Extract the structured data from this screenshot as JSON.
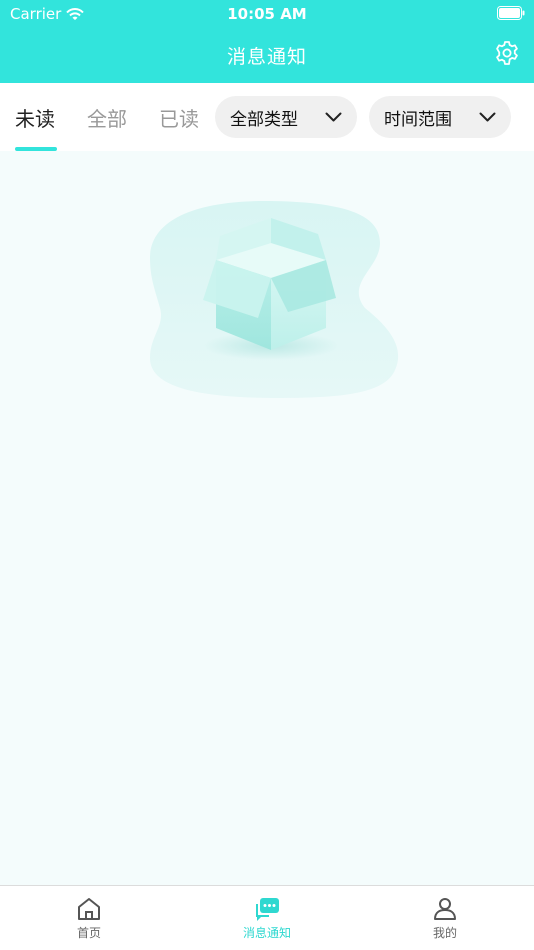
{
  "status_bar": {
    "carrier": "Carrier",
    "time": "10:05 AM"
  },
  "nav": {
    "title": "消息通知",
    "settings_icon": "gear-icon"
  },
  "tabs": [
    {
      "label": "未读",
      "active": true
    },
    {
      "label": "全部",
      "active": false
    },
    {
      "label": "已读",
      "active": false
    }
  ],
  "filters": {
    "type": {
      "label": "全部类型"
    },
    "time_range": {
      "label": "时间范围"
    }
  },
  "empty_state": {
    "icon": "empty-box-icon"
  },
  "tabbar": {
    "items": [
      {
        "label": "首页",
        "icon": "home-icon",
        "active": false
      },
      {
        "label": "消息通知",
        "icon": "message-icon",
        "active": true
      },
      {
        "label": "我的",
        "icon": "user-icon",
        "active": false
      }
    ]
  },
  "colors": {
    "accent": "#32e4dc",
    "background": "#f4fcfc",
    "tab_active": "#2fd8d0"
  }
}
